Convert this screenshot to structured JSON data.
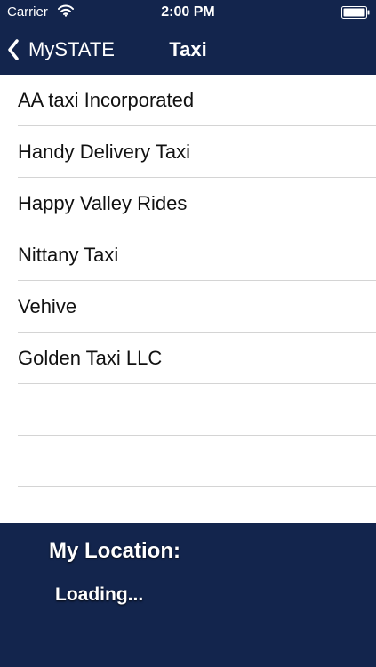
{
  "status_bar": {
    "carrier": "Carrier",
    "time": "2:00 PM",
    "wifi_icon": "wifi-icon",
    "battery_icon": "battery-icon"
  },
  "nav": {
    "back_label": "MySTATE",
    "back_icon": "chevron-left-icon",
    "title": "Taxi"
  },
  "taxi_list": {
    "items": [
      {
        "label": "AA taxi Incorporated"
      },
      {
        "label": "Handy Delivery Taxi"
      },
      {
        "label": "Happy Valley Rides"
      },
      {
        "label": "Nittany Taxi"
      },
      {
        "label": "Vehive"
      },
      {
        "label": "Golden Taxi LLC"
      }
    ]
  },
  "location": {
    "heading": "My Location:",
    "status": "Loading..."
  },
  "colors": {
    "bar_background": "#13254d",
    "list_background": "#ffffff",
    "separator": "#d4d4d4",
    "text_dark": "#111111",
    "text_light": "#ffffff"
  }
}
